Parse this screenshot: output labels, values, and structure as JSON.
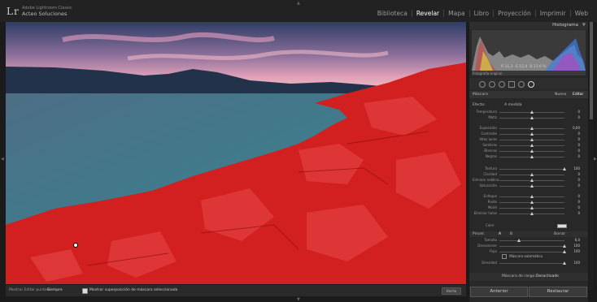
{
  "app": {
    "logo": "Lr",
    "brand_line1": "Adobe Lightroom Classic",
    "brand_line2": "Acteo Soluciones"
  },
  "modules": [
    "Biblioteca",
    "Revelar",
    "Mapa",
    "Libro",
    "Proyección",
    "Imprimir",
    "Web"
  ],
  "active_module": "Revelar",
  "toolbar": {
    "overlay_label": "Mostrar Editar puntos:",
    "overlay_value": "Siempre",
    "show_overlay_label": "Mostrar superposición de máscara seleccionada",
    "done_label": "Hecho"
  },
  "panel": {
    "histogram_title": "Histograma",
    "readout": {
      "r": "11,3",
      "g": "12,4",
      "b": "13,6",
      "unit": "%"
    },
    "original_label": "Fotografía original",
    "mask_title": "Máscara",
    "new_label": "Nuevo",
    "edit_label": "Editar",
    "effect_label": "Efecto:",
    "effect_value": "A medida",
    "sliders": [
      {
        "name": "Temperatura",
        "value": "0",
        "pos": 0.5
      },
      {
        "name": "Matiz",
        "value": "0",
        "pos": 0.5
      },
      {
        "name": "Exposición",
        "value": "0,00",
        "pos": 0.5
      },
      {
        "name": "Contraste",
        "value": "0",
        "pos": 0.5
      },
      {
        "name": "Altas luces",
        "value": "0",
        "pos": 0.5
      },
      {
        "name": "Sombras",
        "value": "0",
        "pos": 0.5
      },
      {
        "name": "Blancos",
        "value": "0",
        "pos": 0.5
      },
      {
        "name": "Negros",
        "value": "0",
        "pos": 0.5
      },
      {
        "name": "Textura",
        "value": "100",
        "pos": 1.0
      },
      {
        "name": "Claridad",
        "value": "0",
        "pos": 0.5
      },
      {
        "name": "Eliminar neblina",
        "value": "0",
        "pos": 0.5
      },
      {
        "name": "Saturación",
        "value": "0",
        "pos": 0.5
      },
      {
        "name": "Enfoque",
        "value": "0",
        "pos": 0.5
      },
      {
        "name": "Ruido",
        "value": "0",
        "pos": 0.5
      },
      {
        "name": "Moiré",
        "value": "0",
        "pos": 0.5
      },
      {
        "name": "Eliminar halos",
        "value": "0",
        "pos": 0.5
      }
    ],
    "color_label": "Color",
    "brush": {
      "title": "Pincel:",
      "a_label": "A",
      "b_label": "B",
      "erase_label": "Borrar"
    },
    "brush_sliders": [
      {
        "name": "Tamaño",
        "value": "6,0",
        "pos": 0.3
      },
      {
        "name": "Desvanecer",
        "value": "100",
        "pos": 1.0
      },
      {
        "name": "Flujo",
        "value": "100",
        "pos": 1.0
      }
    ],
    "auto_mask_label": "Máscara automática",
    "density": {
      "name": "Densidad",
      "value": "100",
      "pos": 1.0
    },
    "range_mask_label": "Máscara de rango:",
    "range_mask_value": "Desactivado",
    "prev_button": "Anterior",
    "reset_button": "Restaurar"
  }
}
